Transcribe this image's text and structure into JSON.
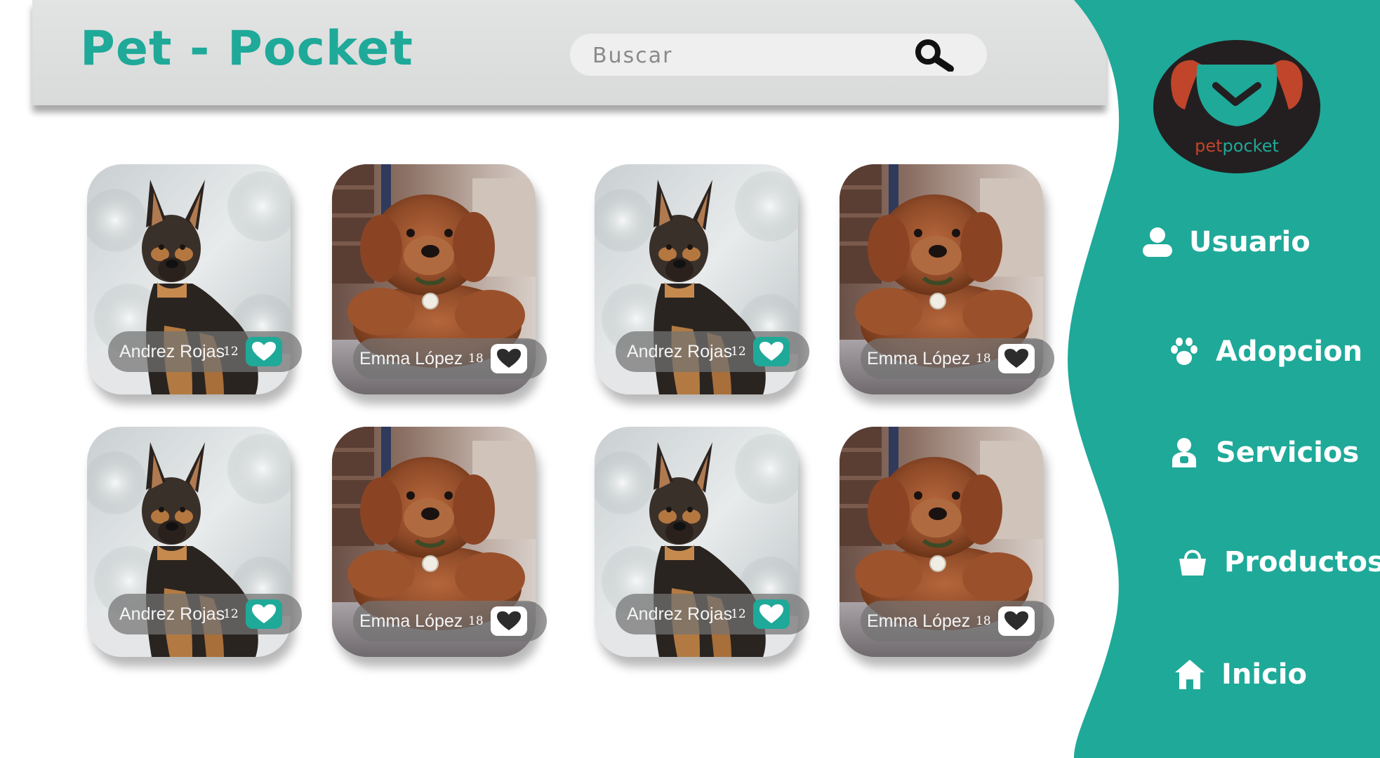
{
  "header": {
    "title": "Pet - Pocket",
    "search_placeholder": "Buscar"
  },
  "sidebar": {
    "logo_text": "petpocket",
    "items": [
      {
        "label": "Usuario",
        "icon": "user-icon"
      },
      {
        "label": "Adopcion",
        "icon": "paw-icon"
      },
      {
        "label": "Servicios",
        "icon": "person-service-icon"
      },
      {
        "label": "Productos",
        "icon": "bag-icon"
      },
      {
        "label": "Inicio",
        "icon": "home-icon"
      }
    ]
  },
  "cards": [
    {
      "owner": "Andrez Rojas",
      "count": "12",
      "pet": "german-shepherd-puppy",
      "like_style": "teal"
    },
    {
      "owner": "Emma López",
      "count": "18",
      "pet": "brown-doodle-puppy",
      "like_style": "white"
    },
    {
      "owner": "Andrez Rojas",
      "count": "12",
      "pet": "german-shepherd-puppy",
      "like_style": "teal"
    },
    {
      "owner": "Emma López",
      "count": "18",
      "pet": "brown-doodle-puppy",
      "like_style": "white"
    },
    {
      "owner": "Andrez Rojas",
      "count": "12",
      "pet": "german-shepherd-puppy",
      "like_style": "teal"
    },
    {
      "owner": "Emma López",
      "count": "18",
      "pet": "brown-doodle-puppy",
      "like_style": "white"
    },
    {
      "owner": "Andrez Rojas",
      "count": "12",
      "pet": "german-shepherd-puppy",
      "like_style": "teal"
    },
    {
      "owner": "Emma López",
      "count": "18",
      "pet": "brown-doodle-puppy",
      "like_style": "white"
    }
  ],
  "colors": {
    "brand_teal": "#1fa999",
    "header_gray": "#dedfdf",
    "logo_dark": "#231f20",
    "logo_ear": "#c0452b"
  }
}
